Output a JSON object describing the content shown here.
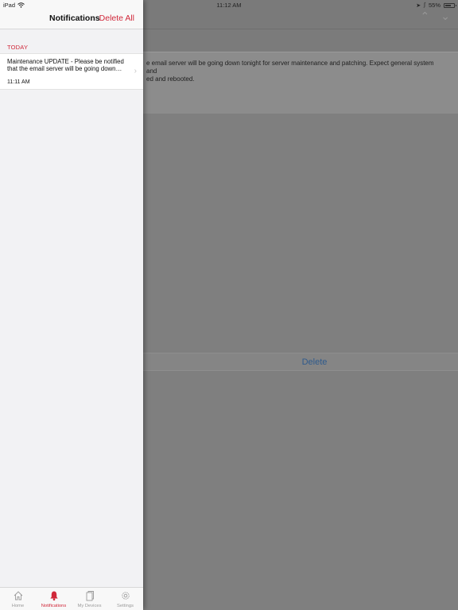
{
  "status_bar": {
    "device": "iPad",
    "time": "11:12 AM",
    "battery": "55%",
    "battery_level": 0.55
  },
  "background": {
    "message_text": "e email server will be going down tonight for server maintenance and patching. Expect general system and",
    "message_text_line2": "ed and rebooted.",
    "delete_label": "Delete"
  },
  "drawer": {
    "title": "Notifications",
    "delete_all": "Delete All",
    "section": "TODAY",
    "notifications": [
      {
        "text": "Maintenance UPDATE - Please be notified that the email server will be going down…",
        "time": "11:11 AM"
      }
    ]
  },
  "tabs": [
    {
      "label": "Home",
      "icon": "home-icon",
      "active": false
    },
    {
      "label": "Notifications",
      "icon": "bell-icon",
      "active": true
    },
    {
      "label": "My Devices",
      "icon": "devices-icon",
      "active": false
    },
    {
      "label": "Settings",
      "icon": "gear-icon",
      "active": false
    }
  ],
  "colors": {
    "accent": "#d0283a",
    "inactive_tab": "#9a9a9a"
  }
}
